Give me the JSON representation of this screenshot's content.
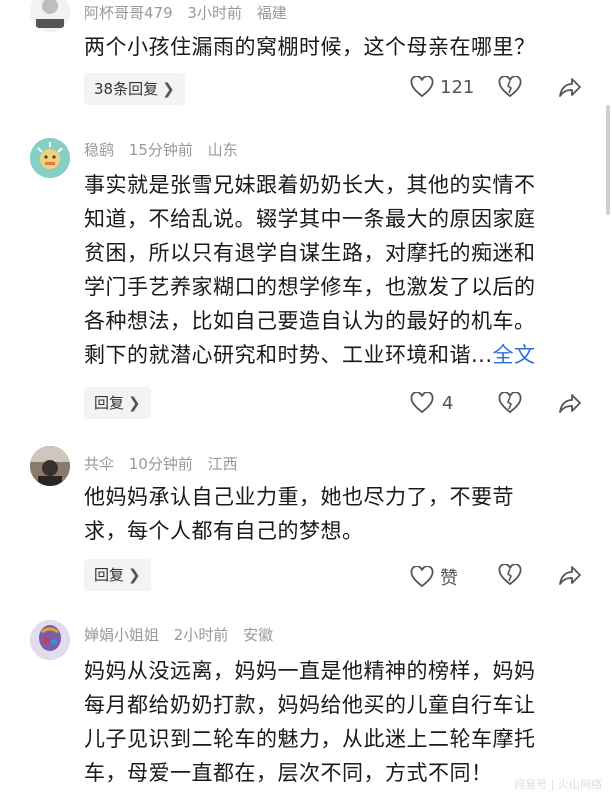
{
  "comments": [
    {
      "username": "阿杯哥哥479",
      "time": "3小时前",
      "location": "福建",
      "lines": [
        "两个小孩住漏雨的窝棚时候，这个母亲在哪里？"
      ],
      "reply_label": "38条回复",
      "like_count": "121",
      "avatar_badge": "个人公众号东北人"
    },
    {
      "username": "稳鹞",
      "time": "15分钟前",
      "location": "山东",
      "lines": [
        "事实就是张雪兄妹跟着奶奶长大，其他的实情不",
        "知道，不给乱说。辍学其中一条最大的原因家庭",
        "贫困，所以只有退学自谋生路，对摩托的痴迷和",
        "学门手艺养家糊口的想学修车，也激发了以后的",
        "各种想法，比如自己要造自认为的最好的机车。",
        "剩下的就潜心研究和时势、工业环境和谐..."
      ],
      "more_label": "全文",
      "reply_label": "回复",
      "like_count": "4"
    },
    {
      "username": "共伞",
      "time": "10分钟前",
      "location": "江西",
      "lines": [
        "他妈妈承认自己业力重，她也尽力了，不要苛",
        "求，每个人都有自己的梦想。"
      ],
      "reply_label": "回复",
      "like_count": "赞"
    },
    {
      "username": "婵娟小姐姐",
      "time": "2小时前",
      "location": "安徽",
      "lines": [
        "妈妈从没远离，妈妈一直是他精神的榜样，妈妈",
        "每月都给奶奶打款，妈妈给他买的儿童自行车让",
        "儿子见识到二轮车的魅力，从此迷上二轮车摩托",
        "车，母爱一直都在，层次不同，方式不同！"
      ]
    }
  ],
  "watermark": "网易号 | 火山网络",
  "icons": {
    "like": "heart-outline-icon",
    "dislike": "broken-heart-icon",
    "share": "share-arrow-icon",
    "chevron": "chevron-right-icon"
  }
}
